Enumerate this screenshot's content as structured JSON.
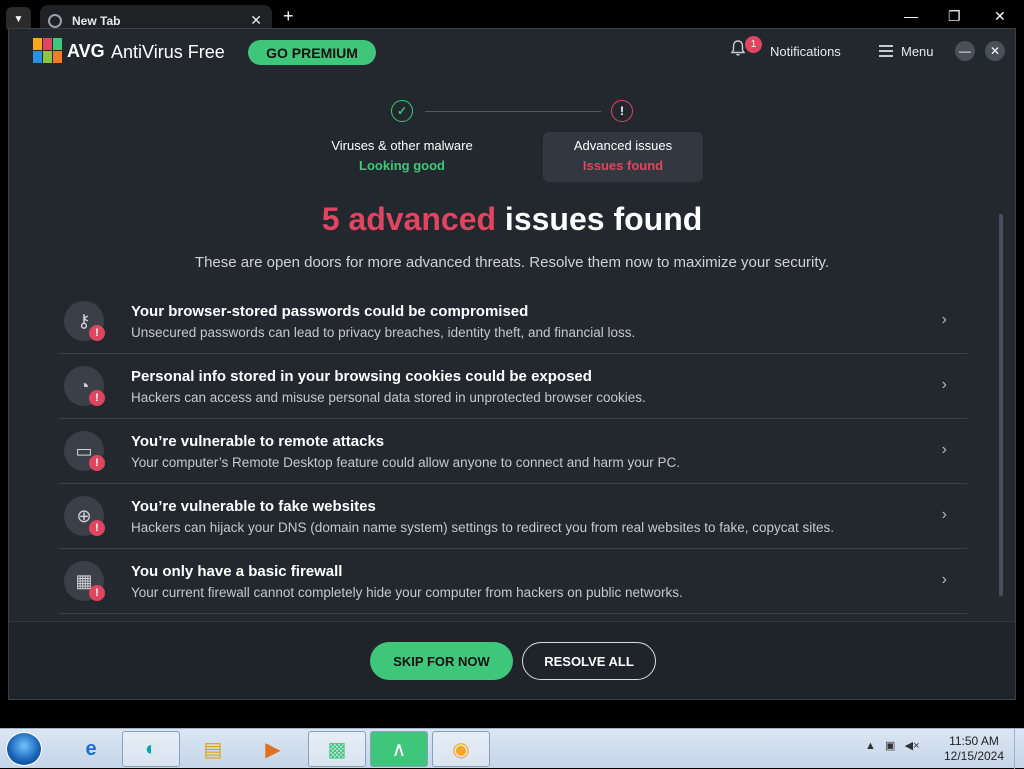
{
  "browser": {
    "tab_title": "New Tab",
    "tab_close": "✕",
    "new_tab": "+",
    "minimize": "—",
    "restore": "❐",
    "close": "✕"
  },
  "app": {
    "brand": "AVG",
    "product": "AntiVirus Free",
    "premium_label": "GO PREMIUM",
    "notif_count": "1",
    "notif_label": "Notifications",
    "menu_label": "Menu",
    "colors": {
      "accent_green": "#3ec77a",
      "alert_red": "#e0445f",
      "background": "#23282f"
    }
  },
  "steps": [
    {
      "title": "Viruses & other malware",
      "status": "Looking good",
      "icon": "check-icon"
    },
    {
      "title": "Advanced issues",
      "status": "Issues found",
      "icon": "exclamation-icon"
    }
  ],
  "headline": {
    "accent": "5 advanced",
    "rest": " issues found"
  },
  "subtitle": "These are open doors for more advanced threats. Resolve them now to maximize your security.",
  "issues": [
    {
      "title": "Your browser-stored passwords could be compromised",
      "desc": "Unsecured passwords can lead to privacy breaches, identity theft, and financial loss.",
      "icon": "key-icon"
    },
    {
      "title": "Personal info stored in your browsing cookies could be exposed",
      "desc": "Hackers can access and misuse personal data stored in unprotected browser cookies.",
      "icon": "cookie-icon"
    },
    {
      "title": "You’re vulnerable to remote attacks",
      "desc": "Your computer’s Remote Desktop feature could allow anyone to connect and harm your PC.",
      "icon": "remote-desktop-icon"
    },
    {
      "title": "You’re vulnerable to fake websites",
      "desc": "Hackers can hijack your DNS (domain name system) settings to redirect you from real websites to fake, copycat sites.",
      "icon": "globe-icon"
    },
    {
      "title": "You only have a basic firewall",
      "desc": "Your current firewall cannot completely hide your computer from hackers on public networks.",
      "icon": "firewall-icon"
    }
  ],
  "footer": {
    "skip_label": "SKIP FOR NOW",
    "resolve_label": "RESOLVE ALL"
  },
  "taskbar": {
    "time": "11:50 AM",
    "date": "12/15/2024"
  }
}
